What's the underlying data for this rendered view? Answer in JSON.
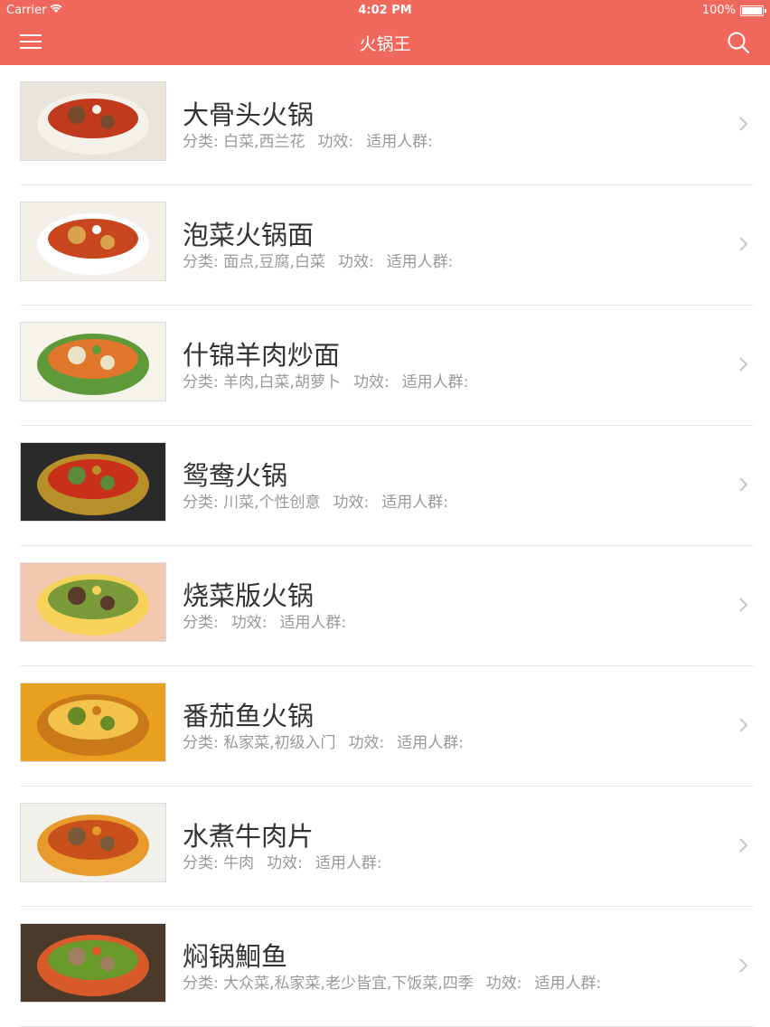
{
  "status_bar": {
    "carrier": "Carrier",
    "time": "4:02 PM",
    "battery": "100%"
  },
  "navbar": {
    "title": "火锅王",
    "left_icon": "menu-icon",
    "right_icon": "search-icon"
  },
  "colors": {
    "accent": "#F0685B",
    "title_text": "#333333",
    "meta_text": "#999999"
  },
  "recipes": [
    {
      "title": "大骨头火锅",
      "category_label": "分类: 白菜,西兰花",
      "effect_label": "功效:",
      "audience_label": "适用人群:"
    },
    {
      "title": "泡菜火锅面",
      "category_label": "分类: 面点,豆腐,白菜",
      "effect_label": "功效:",
      "audience_label": "适用人群:"
    },
    {
      "title": "什锦羊肉炒面",
      "category_label": "分类: 羊肉,白菜,胡萝卜",
      "effect_label": "功效:",
      "audience_label": "适用人群:"
    },
    {
      "title": "鸳鸯火锅",
      "category_label": "分类: 川菜,个性创意",
      "effect_label": "功效:",
      "audience_label": "适用人群:"
    },
    {
      "title": "烧菜版火锅",
      "category_label": "分类:",
      "effect_label": "功效:",
      "audience_label": "适用人群:"
    },
    {
      "title": "番茄鱼火锅",
      "category_label": "分类: 私家菜,初级入门",
      "effect_label": "功效:",
      "audience_label": "适用人群:"
    },
    {
      "title": "水煮牛肉片",
      "category_label": "分类: 牛肉",
      "effect_label": "功效:",
      "audience_label": "适用人群:"
    },
    {
      "title": "焖锅鮰鱼",
      "category_label": "分类: 大众菜,私家菜,老少皆宜,下饭菜,四季",
      "effect_label": "功效:",
      "audience_label": "适用人群:"
    }
  ]
}
